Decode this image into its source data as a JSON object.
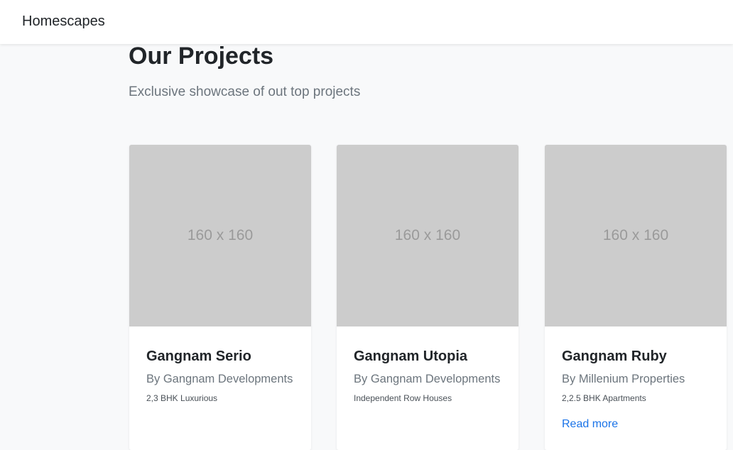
{
  "nav": {
    "brand": "Homescapes"
  },
  "header": {
    "title": "Our Projects",
    "subtitle": "Exclusive showcase of out top projects"
  },
  "projects": [
    {
      "image_placeholder": "160 x 160",
      "title": "Gangnam Serio",
      "developer": "By Gangnam Developments",
      "type": "2,3 BHK Luxurious"
    },
    {
      "image_placeholder": "160 x 160",
      "title": "Gangnam Utopia",
      "developer": "By Gangnam Developments",
      "type": "Independent Row Houses"
    },
    {
      "image_placeholder": "160 x 160",
      "title": "Gangnam Ruby",
      "developer": "By Millenium Properties",
      "type": "2,2.5 BHK Apartments",
      "link_label": "Read more"
    }
  ],
  "colors": {
    "page_background": "#f8f9fa",
    "placeholder_background": "#cccccc",
    "link": "#1a73e8"
  }
}
